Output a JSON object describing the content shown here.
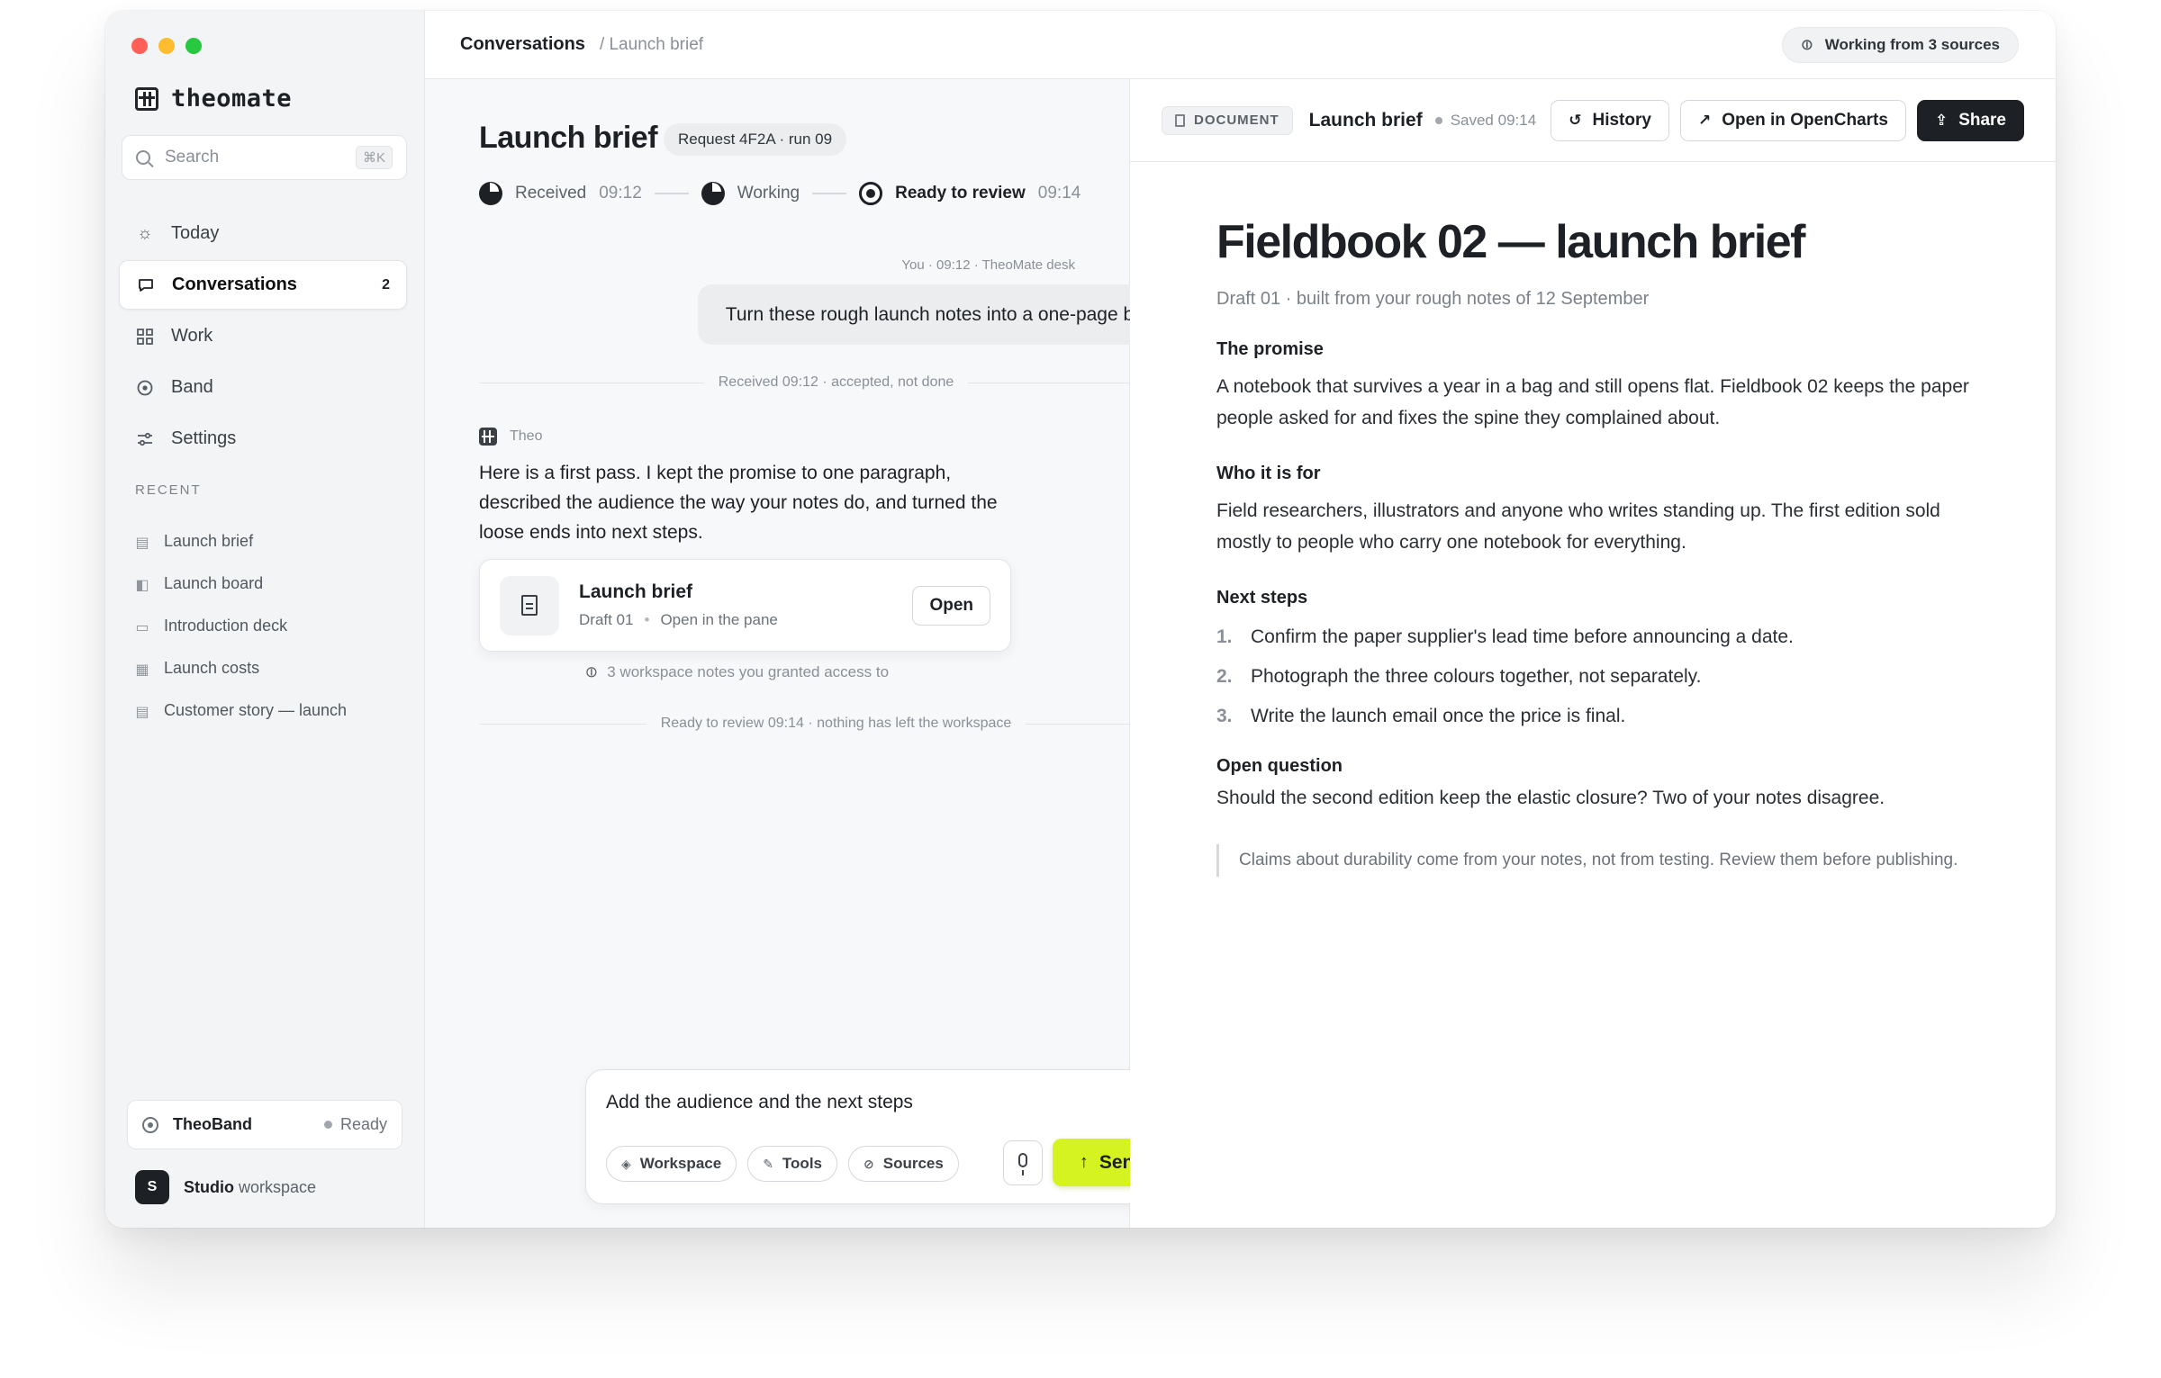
{
  "app": {
    "brand_name": "theomate",
    "colors": {
      "accent": "#d4f321",
      "dark": "#1d2125"
    }
  },
  "sidebar": {
    "search_placeholder": "Search",
    "search_shortcut": "⌘K",
    "nav": [
      {
        "label": "Today",
        "icon": "sun-icon"
      },
      {
        "label": "Conversations",
        "icon": "chat-icon",
        "count": "2",
        "active": true
      },
      {
        "label": "Work",
        "icon": "grid-icon"
      },
      {
        "label": "Band",
        "icon": "target-icon"
      },
      {
        "label": "Settings",
        "icon": "sliders-icon"
      }
    ],
    "recent_label": "RECENT",
    "recent": [
      {
        "label": "Launch brief",
        "icon": "document-icon"
      },
      {
        "label": "Launch board",
        "icon": "board-icon"
      },
      {
        "label": "Introduction deck",
        "icon": "presentation-icon"
      },
      {
        "label": "Launch costs",
        "icon": "table-icon"
      },
      {
        "label": "Customer story — launch",
        "icon": "document-icon"
      }
    ],
    "band": {
      "name": "TheoBand",
      "status": "Ready"
    },
    "workspace": {
      "avatar": "S",
      "name": "Studio",
      "suffix": "workspace"
    }
  },
  "topbar": {
    "crumb_main": "Conversations",
    "crumb_sub": "/ Launch brief",
    "sources_label": "Working from 3 sources"
  },
  "chat": {
    "title": "Launch brief",
    "request_pill": "Request 4F2A · run 09",
    "steps": [
      {
        "label": "Received",
        "time": "09:12"
      },
      {
        "label": "Working",
        "time": ""
      },
      {
        "label": "Ready to review",
        "time": "09:14"
      }
    ],
    "user_meta": "You · 09:12 · TheoMate desk",
    "user_message": "Turn these rough launch notes into a one-page brief.",
    "divider_received": "Received 09:12 · accepted, not done",
    "assistant_name": "Theo",
    "assistant_message": "Here is a first pass. I kept the promise to one paragraph, described the audience the way your notes do, and turned the loose ends into next steps.",
    "card": {
      "title": "Launch brief",
      "draft": "Draft 01",
      "location": "Open in the pane",
      "open_label": "Open"
    },
    "access_note": "3 workspace notes you granted access to",
    "divider_ready": "Ready to review 09:14 · nothing has left the workspace",
    "composer": {
      "text": "Add the audience and the next steps",
      "chips": [
        "Workspace",
        "Tools",
        "Sources"
      ],
      "send_label": "Send"
    }
  },
  "document": {
    "tag": "DOCUMENT",
    "title": "Launch brief",
    "saved": "Saved 09:14",
    "history_label": "History",
    "open_external_label": "Open in OpenCharts",
    "share_label": "Share",
    "h1": "Fieldbook 02 — launch brief",
    "subtitle": "Draft 01 · built from your rough notes of 12 September",
    "sections": {
      "promise_title": "The promise",
      "promise_text": "A notebook that survives a year in a bag and still opens flat. Fieldbook 02 keeps the paper people asked for and fixes the spine they complained about.",
      "audience_title": "Who it is for",
      "audience_text": "Field researchers, illustrators and anyone who writes standing up. The first edition sold mostly to people who carry one notebook for everything.",
      "next_title": "Next steps",
      "next_steps": [
        "Confirm the paper supplier's lead time before announcing a date.",
        "Photograph the three colours together, not separately.",
        "Write the launch email once the price is final."
      ],
      "question_title": "Open question",
      "question_text": "Should the second edition keep the elastic closure? Two of your notes disagree.",
      "note": "Claims about durability come from your notes, not from testing. Review them before publishing."
    }
  }
}
